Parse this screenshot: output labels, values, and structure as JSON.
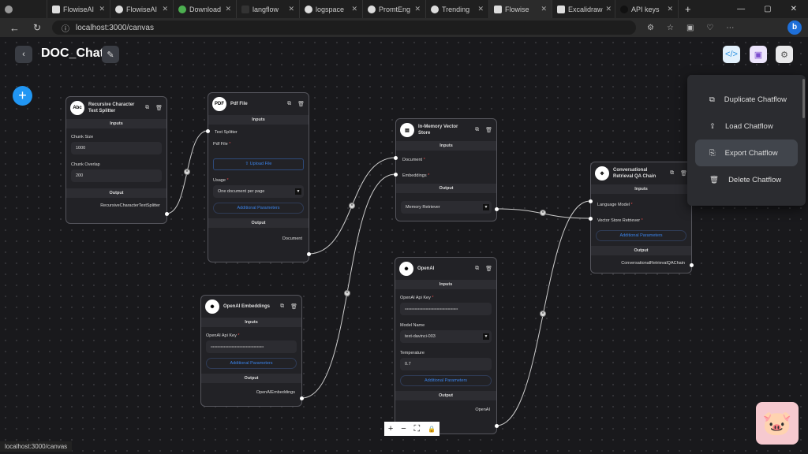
{
  "browser": {
    "tabs": [
      "FlowiseAI",
      "FlowiseAI",
      "Download",
      "langflow",
      "logspace",
      "PromtEng",
      "Trending",
      "Flowise",
      "Excalidraw",
      "API keys"
    ],
    "url": "localhost:3000/canvas",
    "status_url": "localhost:3000/canvas"
  },
  "header": {
    "title": "DOC_Chat"
  },
  "menu": {
    "items": [
      "Duplicate Chatflow",
      "Load Chatflow",
      "Export Chatflow",
      "Delete Chatflow"
    ]
  },
  "labels": {
    "inputs": "Inputs",
    "output": "Output",
    "additional": "Additional Parameters"
  },
  "nodes": {
    "splitter": {
      "icon": "Abc",
      "title": "Recursive Character Text Splitter",
      "chunk_size_label": "Chunk Size",
      "chunk_size": "1000",
      "overlap_label": "Chunk Overlap",
      "overlap": "200",
      "output": "RecursiveCharacterTextSplitter"
    },
    "pdf": {
      "icon": "PDF",
      "title": "Pdf File",
      "text_splitter": "Text Splitter",
      "pdf_label": "Pdf File",
      "upload": "Upload File",
      "usage_label": "Usage",
      "usage": "One document per page",
      "output": "Document"
    },
    "memory": {
      "title": "In-Memory Vector Store",
      "document": "Document",
      "embeddings": "Embeddings",
      "output": "Memory Retriever"
    },
    "chain": {
      "title": "Conversational Retrieval QA Chain",
      "llm": "Language Model",
      "retriever": "Vector Store Retriever",
      "output": "ConversationalRetrievalQAChain"
    },
    "embeddings": {
      "title": "OpenAI Embeddings",
      "key_label": "OpenAI Api Key",
      "key": "••••••••••••••••••••••••••••••••••••••••••••••••",
      "output": "OpenAIEmbeddings"
    },
    "openai": {
      "title": "OpenAI",
      "key_label": "OpenAI Api Key",
      "key": "••••••••••••••••••••••••••••••••••••••••••••••••",
      "model_label": "Model Name",
      "model": "text-davinci-003",
      "temp_label": "Temperature",
      "temp": "0.7",
      "output": "OpenAI"
    }
  }
}
